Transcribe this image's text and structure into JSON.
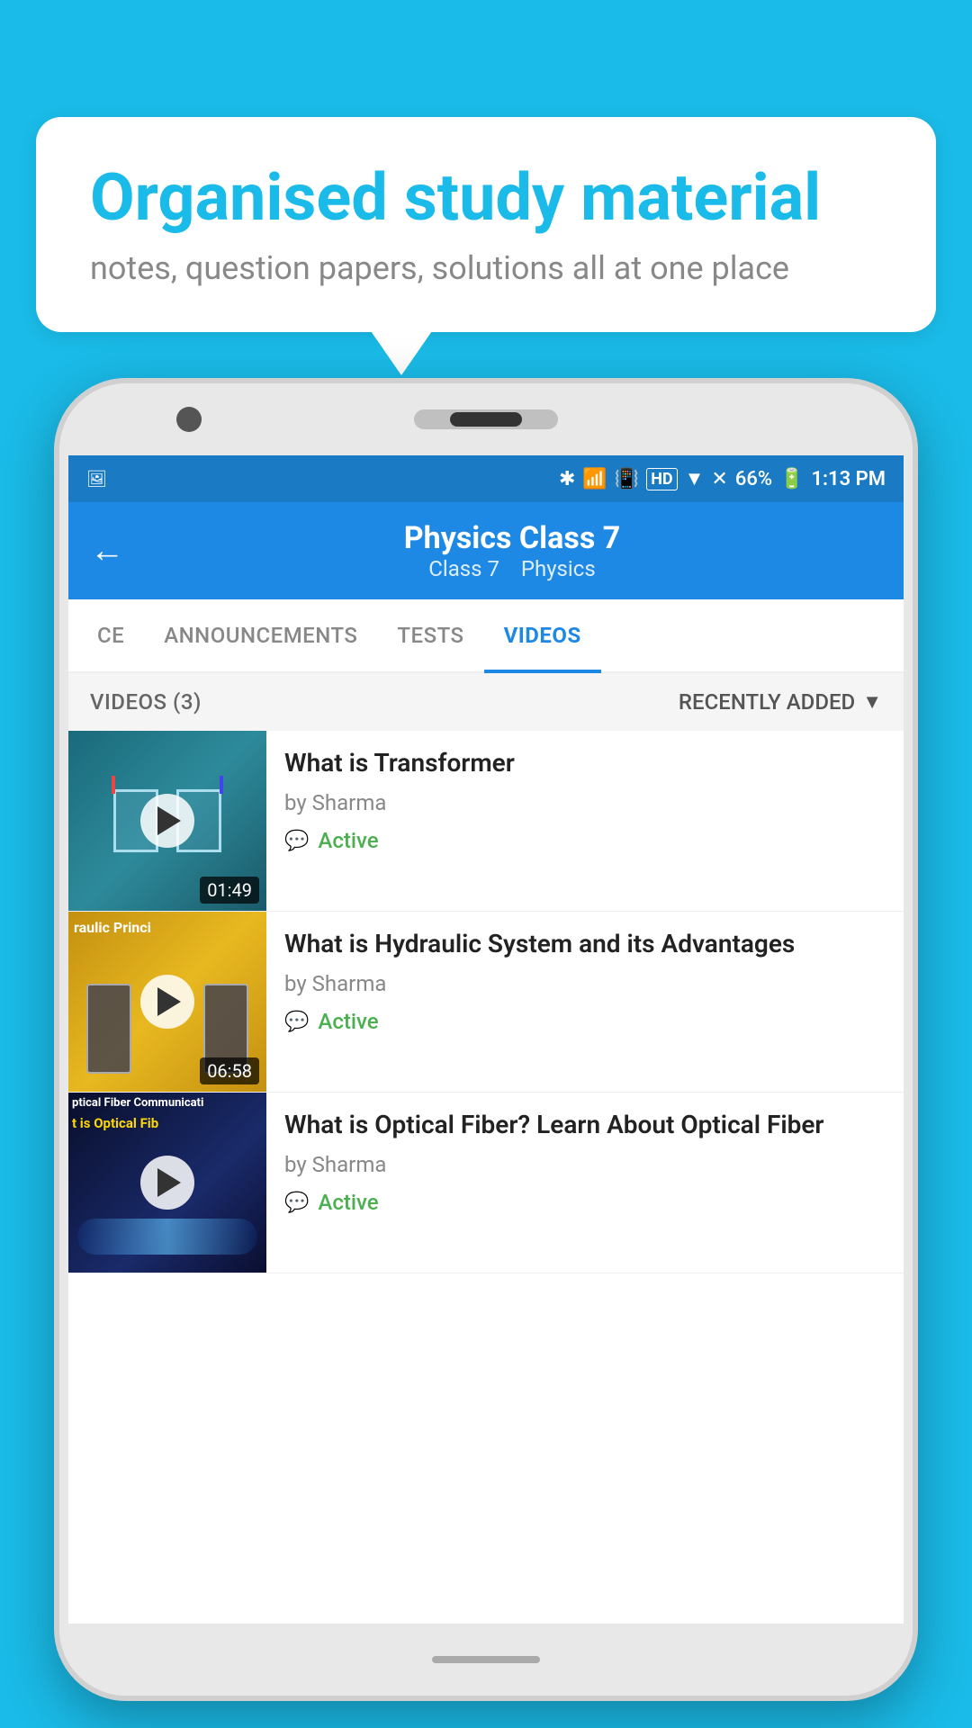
{
  "bubble": {
    "title": "Organised study material",
    "subtitle": "notes, question papers, solutions all at one place"
  },
  "status_bar": {
    "battery": "66%",
    "time": "1:13 PM"
  },
  "header": {
    "title": "Physics Class 7",
    "subtitle_class": "Class 7",
    "subtitle_subject": "Physics",
    "back_label": "←"
  },
  "tabs": [
    {
      "label": "CE",
      "active": false
    },
    {
      "label": "ANNOUNCEMENTS",
      "active": false
    },
    {
      "label": "TESTS",
      "active": false
    },
    {
      "label": "VIDEOS",
      "active": true
    }
  ],
  "videos_header": {
    "count_label": "VIDEOS (3)",
    "sort_label": "RECENTLY ADDED"
  },
  "videos": [
    {
      "title": "What is  Transformer",
      "author": "by Sharma",
      "status": "Active",
      "duration": "01:49",
      "thumb_type": "1"
    },
    {
      "title": "What is Hydraulic System and its Advantages",
      "author": "by Sharma",
      "status": "Active",
      "duration": "06:58",
      "thumb_type": "2"
    },
    {
      "title": "What is Optical Fiber? Learn About Optical Fiber",
      "author": "by Sharma",
      "status": "Active",
      "duration": "",
      "thumb_type": "3"
    }
  ],
  "thumb_labels": {
    "hydraulic": "raulic Princi",
    "fiber_1": "ptical Fiber Communicati",
    "fiber_2": "t is Optical Fib"
  }
}
